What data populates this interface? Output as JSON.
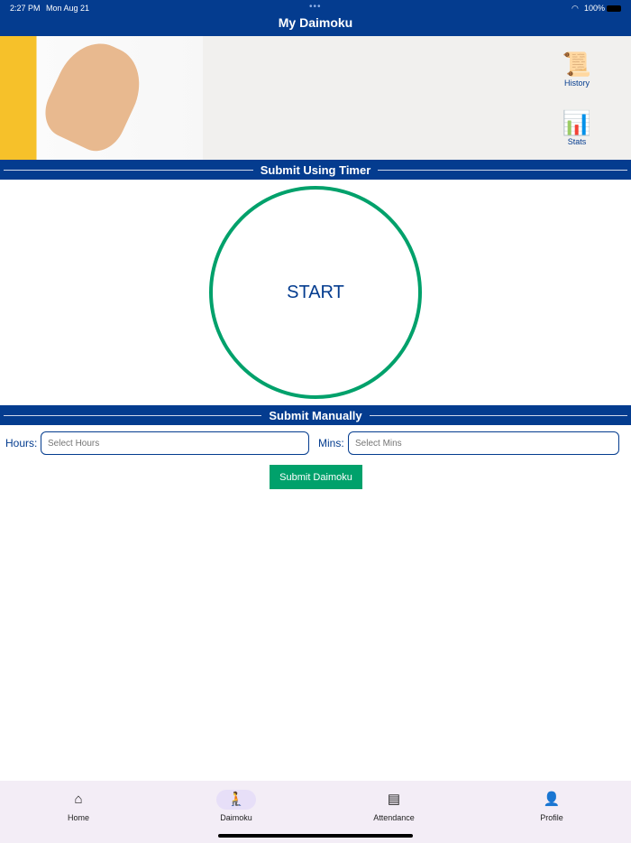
{
  "status": {
    "time": "2:27 PM",
    "date": "Mon Aug 21",
    "battery": "100%"
  },
  "header": {
    "title": "My Daimoku"
  },
  "banner": {
    "history_label": "History",
    "stats_label": "Stats"
  },
  "timer": {
    "section_title": "Submit Using Timer",
    "start_label": "START"
  },
  "manual": {
    "section_title": "Submit Manually",
    "hours_label": "Hours:",
    "hours_placeholder": "Select Hours",
    "mins_label": "Mins:",
    "mins_placeholder": "Select Mins",
    "submit_label": "Submit Daimoku"
  },
  "nav": {
    "items": [
      {
        "label": "Home",
        "icon": "home-icon"
      },
      {
        "label": "Daimoku",
        "icon": "praying-icon"
      },
      {
        "label": "Attendance",
        "icon": "clipboard-icon"
      },
      {
        "label": "Profile",
        "icon": "person-icon"
      }
    ],
    "active": "Daimoku"
  },
  "colors": {
    "primary": "#043c8f",
    "accent": "#00a16b"
  }
}
